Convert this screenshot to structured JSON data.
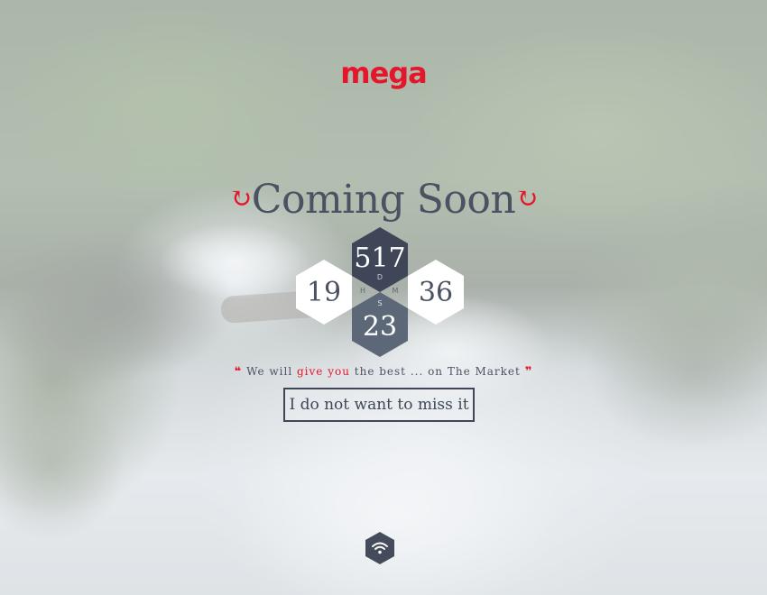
{
  "brand": {
    "logo_text": "mega",
    "accent_color": "#e4162b"
  },
  "hero": {
    "title": "Coming Soon",
    "title_icon_left": "refresh-icon",
    "title_icon_right": "refresh-icon",
    "title_symbol": "↻"
  },
  "countdown": {
    "days": {
      "value": "517",
      "unit": "D"
    },
    "hours": {
      "value": "19",
      "unit": "H"
    },
    "minutes": {
      "value": "36",
      "unit": "M"
    },
    "seconds": {
      "value": "23",
      "unit": "S"
    }
  },
  "tagline": {
    "open_quote": "❝",
    "before": "We will ",
    "highlight": "give you",
    "after": " the best ... on The Market",
    "close_quote": "❞"
  },
  "cta": {
    "label": "I do not want to miss it"
  },
  "footer": {
    "icon": "wifi-icon"
  }
}
